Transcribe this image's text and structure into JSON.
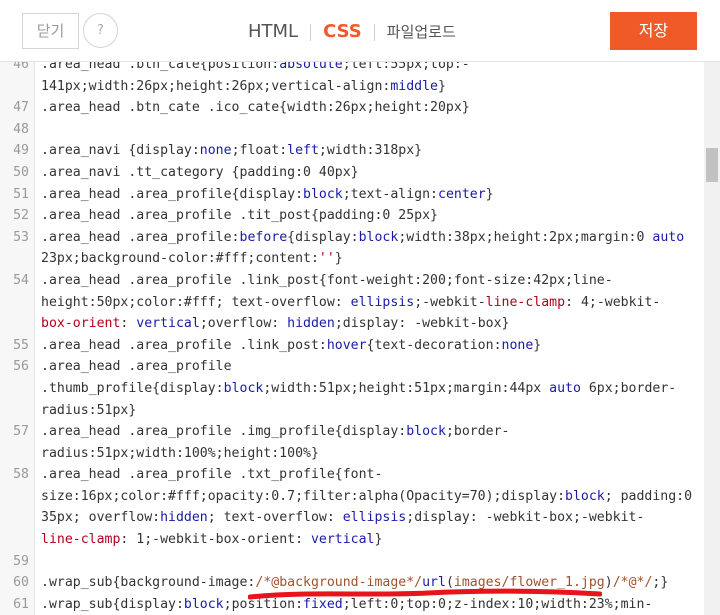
{
  "toolbar": {
    "close_label": "닫기",
    "help_label": "?",
    "tabs": [
      {
        "label": "HTML",
        "active": false
      },
      {
        "label": "CSS",
        "active": true
      },
      {
        "label": "파일업로드",
        "active": false
      }
    ],
    "save_label": "저장",
    "accent_color": "#f05a28"
  },
  "editor": {
    "lines": [
      {
        "num": "46",
        "segs": [
          [
            ".area_head .btn_cate{position:",
            ""
          ],
          [
            "absolute",
            "kw"
          ],
          [
            ";left:55px;top:-",
            ""
          ]
        ]
      },
      {
        "num": "",
        "segs": [
          [
            "141px;width:26px;height:26px;vertical-align:",
            ""
          ],
          [
            "middle",
            "kw"
          ],
          [
            "}",
            ""
          ]
        ]
      },
      {
        "num": "47",
        "segs": [
          [
            ".area_head .btn_cate .ico_cate{width:26px;height:20px}",
            ""
          ]
        ]
      },
      {
        "num": "48",
        "segs": []
      },
      {
        "num": "49",
        "segs": [
          [
            ".area_navi {display:",
            ""
          ],
          [
            "none",
            "kw"
          ],
          [
            ";float:",
            ""
          ],
          [
            "left",
            "kw"
          ],
          [
            ";width:318px}",
            ""
          ]
        ]
      },
      {
        "num": "50",
        "segs": [
          [
            ".area_navi .tt_category {padding:0 40px}",
            ""
          ]
        ]
      },
      {
        "num": "51",
        "segs": [
          [
            ".area_head .area_profile{display:",
            ""
          ],
          [
            "block",
            "kw"
          ],
          [
            ";text-align:",
            ""
          ],
          [
            "center",
            "kw"
          ],
          [
            "}",
            ""
          ]
        ]
      },
      {
        "num": "52",
        "segs": [
          [
            ".area_head .area_profile .tit_post{padding:0 25px}",
            ""
          ]
        ]
      },
      {
        "num": "53",
        "segs": [
          [
            ".area_head .area_profile:",
            ""
          ],
          [
            "before",
            "kw"
          ],
          [
            "{display:",
            ""
          ],
          [
            "block",
            "kw"
          ],
          [
            ";width:38px;height:2px;margin:0 ",
            ""
          ],
          [
            "auto",
            "kw"
          ]
        ]
      },
      {
        "num": "",
        "segs": [
          [
            "23px;background-color:#fff;content:",
            ""
          ],
          [
            "''",
            "st"
          ],
          [
            "}",
            ""
          ]
        ]
      },
      {
        "num": "54",
        "segs": [
          [
            ".area_head .area_profile .link_post{font-weight:200;font-size:42px;line-",
            ""
          ]
        ]
      },
      {
        "num": "",
        "segs": [
          [
            "height:50px;color:#fff; text-overflow: ",
            ""
          ],
          [
            "ellipsis",
            "kw"
          ],
          [
            ";-webkit-",
            ""
          ],
          [
            "line-clamp",
            "st"
          ],
          [
            ": 4;-webkit-",
            ""
          ]
        ]
      },
      {
        "num": "",
        "segs": [
          [
            "box-orient",
            "st"
          ],
          [
            ": ",
            ""
          ],
          [
            "vertical",
            "kw"
          ],
          [
            ";overflow: ",
            ""
          ],
          [
            "hidden",
            "kw"
          ],
          [
            ";display: -webkit-box}",
            ""
          ]
        ]
      },
      {
        "num": "55",
        "segs": [
          [
            ".area_head .area_profile .link_post:",
            ""
          ],
          [
            "hover",
            "kw"
          ],
          [
            "{text-decoration:",
            ""
          ],
          [
            "none",
            "kw"
          ],
          [
            "}",
            ""
          ]
        ]
      },
      {
        "num": "56",
        "segs": [
          [
            ".area_head .area_profile",
            ""
          ]
        ]
      },
      {
        "num": "",
        "segs": [
          [
            ".thumb_profile{display:",
            ""
          ],
          [
            "block",
            "kw"
          ],
          [
            ";width:51px;height:51px;margin:44px ",
            ""
          ],
          [
            "auto",
            "kw"
          ],
          [
            " 6px;border-",
            ""
          ]
        ]
      },
      {
        "num": "",
        "segs": [
          [
            "radius:51px}",
            ""
          ]
        ]
      },
      {
        "num": "57",
        "segs": [
          [
            ".area_head .area_profile .img_profile{display:",
            ""
          ],
          [
            "block",
            "kw"
          ],
          [
            ";border-",
            ""
          ]
        ]
      },
      {
        "num": "",
        "segs": [
          [
            "radius:51px;width:100%;height:100%}",
            ""
          ]
        ]
      },
      {
        "num": "58",
        "segs": [
          [
            ".area_head .area_profile .txt_profile{font-",
            ""
          ]
        ]
      },
      {
        "num": "",
        "segs": [
          [
            "size:16px;color:#fff;opacity:0.7;filter:alpha(Opacity=70);display:",
            ""
          ],
          [
            "block",
            "kw"
          ],
          [
            "; padding:0",
            ""
          ]
        ]
      },
      {
        "num": "",
        "segs": [
          [
            "35px; overflow:",
            ""
          ],
          [
            "hidden",
            "kw"
          ],
          [
            "; text-overflow: ",
            ""
          ],
          [
            "ellipsis",
            "kw"
          ],
          [
            ";display: -webkit-box;-webkit-",
            ""
          ]
        ]
      },
      {
        "num": "",
        "segs": [
          [
            "line-clamp",
            "st"
          ],
          [
            ": 1;-webkit-box-orient: ",
            ""
          ],
          [
            "vertical",
            "kw"
          ],
          [
            "}",
            ""
          ]
        ]
      },
      {
        "num": "59",
        "segs": []
      },
      {
        "num": "60",
        "segs": [
          [
            ".wrap_sub{background-image:",
            ""
          ],
          [
            "/*@background-image*/",
            "cm"
          ],
          [
            "url",
            "kw"
          ],
          [
            "(",
            ""
          ],
          [
            "images/flower_1.jpg",
            "cm"
          ],
          [
            ")",
            ""
          ],
          [
            "/*@*/",
            "cm"
          ],
          [
            ";}",
            ""
          ]
        ]
      },
      {
        "num": "61",
        "segs": [
          [
            ".wrap_sub{display:",
            ""
          ],
          [
            "block",
            "kw"
          ],
          [
            ";position:",
            ""
          ],
          [
            "fixed",
            "kw"
          ],
          [
            ";left:0;top:0;z-index:10;width:23%;min-",
            ""
          ]
        ]
      }
    ]
  }
}
